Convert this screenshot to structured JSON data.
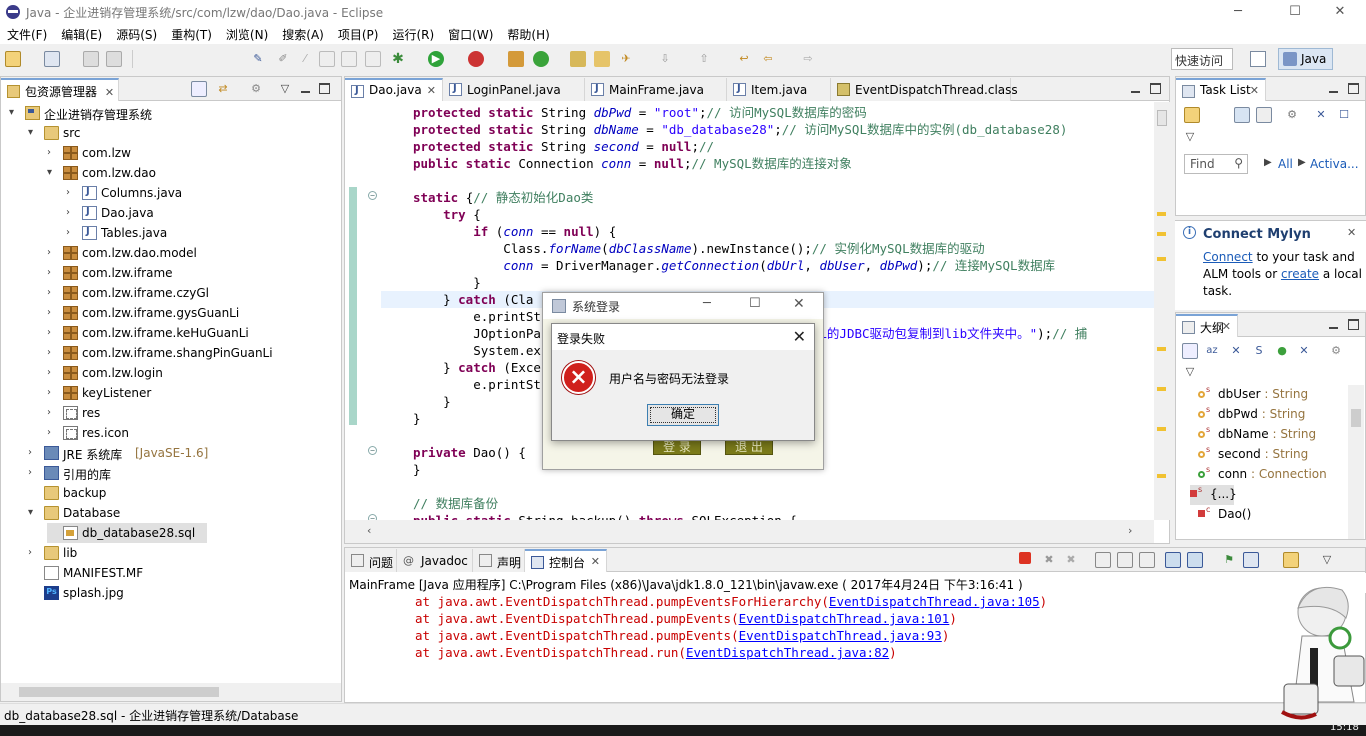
{
  "window": {
    "title": "Java - 企业进销存管理系统/src/com/lzw/dao/Dao.java - Eclipse",
    "min": "─",
    "max": "☐",
    "close": "✕"
  },
  "menu": [
    "文件(F)",
    "编辑(E)",
    "源码(S)",
    "重构(T)",
    "浏览(N)",
    "搜索(A)",
    "项目(P)",
    "运行(R)",
    "窗口(W)",
    "帮助(H)"
  ],
  "toolbar": {
    "quick_access": "快速访问",
    "perspective": "Java"
  },
  "package_explorer": {
    "tab": "包资源管理器",
    "rows": [
      {
        "label": "企业进销存管理系统",
        "twisty": "▾",
        "icon": "project"
      },
      {
        "label": "src",
        "twisty": "▾",
        "icon": "package-folder"
      },
      {
        "label": "com.lzw",
        "twisty": "›",
        "icon": "package"
      },
      {
        "label": "com.lzw.dao",
        "twisty": "▾",
        "icon": "package"
      },
      {
        "label": "Columns.java",
        "twisty": "›",
        "icon": "java-file"
      },
      {
        "label": "Dao.java",
        "twisty": "›",
        "icon": "java-file"
      },
      {
        "label": "Tables.java",
        "twisty": "›",
        "icon": "java-file"
      },
      {
        "label": "com.lzw.dao.model",
        "twisty": "›",
        "icon": "package"
      },
      {
        "label": "com.lzw.iframe",
        "twisty": "›",
        "icon": "package"
      },
      {
        "label": "com.lzw.iframe.czyGl",
        "twisty": "›",
        "icon": "package"
      },
      {
        "label": "com.lzw.iframe.gysGuanLi",
        "twisty": "›",
        "icon": "package"
      },
      {
        "label": "com.lzw.iframe.keHuGuanLi",
        "twisty": "›",
        "icon": "package"
      },
      {
        "label": "com.lzw.iframe.shangPinGuanLi",
        "twisty": "›",
        "icon": "package"
      },
      {
        "label": "com.lzw.login",
        "twisty": "›",
        "icon": "package"
      },
      {
        "label": "keyListener",
        "twisty": "›",
        "icon": "package"
      },
      {
        "label": "res",
        "twisty": "›",
        "icon": "resource-folder"
      },
      {
        "label": "res.icon",
        "twisty": "›",
        "icon": "resource-folder"
      },
      {
        "label": "JRE 系统库",
        "suffix": "[JavaSE-1.6]",
        "twisty": "›",
        "icon": "library"
      },
      {
        "label": "引用的库",
        "twisty": "›",
        "icon": "library"
      },
      {
        "label": "backup",
        "twisty": "",
        "icon": "folder"
      },
      {
        "label": "Database",
        "twisty": "▾",
        "icon": "folder"
      },
      {
        "label": "db_database28.sql",
        "twisty": "",
        "icon": "sql-file"
      },
      {
        "label": "lib",
        "twisty": "›",
        "icon": "folder"
      },
      {
        "label": "MANIFEST.MF",
        "twisty": "",
        "icon": "file"
      },
      {
        "label": "splash.jpg",
        "twisty": "",
        "icon": "image-file"
      }
    ]
  },
  "editor": {
    "tabs": [
      "Dao.java",
      "LoginPanel.java",
      "MainFrame.java",
      "Item.java",
      "EventDispatchThread.class"
    ],
    "lines": [
      [
        [
          "kw",
          "protected static "
        ],
        [
          "t",
          "String "
        ],
        [
          "fld",
          "dbPwd"
        ],
        [
          "t",
          " = "
        ],
        [
          "str",
          "\"root\""
        ],
        [
          "t",
          ";"
        ],
        [
          "cmt",
          "// 访问MySQL数据库的密码"
        ]
      ],
      [
        [
          "kw",
          "protected static "
        ],
        [
          "t",
          "String "
        ],
        [
          "fld",
          "dbName"
        ],
        [
          "t",
          " = "
        ],
        [
          "str",
          "\"db_database28\""
        ],
        [
          "t",
          ";"
        ],
        [
          "cmt",
          "// 访问MySQL数据库中的实例(db_database28)"
        ]
      ],
      [
        [
          "kw",
          "protected static "
        ],
        [
          "t",
          "String "
        ],
        [
          "fld",
          "second"
        ],
        [
          "t",
          " = "
        ],
        [
          "kw",
          "null"
        ],
        [
          "t",
          ";"
        ],
        [
          "cmt",
          "//"
        ]
      ],
      [
        [
          "kw",
          "public static "
        ],
        [
          "t",
          "Connection "
        ],
        [
          "fld",
          "conn"
        ],
        [
          "t",
          " = "
        ],
        [
          "kw",
          "null"
        ],
        [
          "t",
          ";"
        ],
        [
          "cmt",
          "// MySQL数据库的连接对象"
        ]
      ],
      [
        [
          "t",
          ""
        ]
      ],
      [
        [
          "kw",
          "static "
        ],
        [
          "t",
          "{"
        ],
        [
          "cmt",
          "// 静态初始化Dao类"
        ]
      ],
      [
        [
          "t",
          "    "
        ],
        [
          "kw",
          "try "
        ],
        [
          "t",
          "{"
        ]
      ],
      [
        [
          "t",
          "        "
        ],
        [
          "kw",
          "if "
        ],
        [
          "t",
          "("
        ],
        [
          "fld",
          "conn"
        ],
        [
          "t",
          " == "
        ],
        [
          "kw",
          "null"
        ],
        [
          "t",
          ") {"
        ]
      ],
      [
        [
          "t",
          "            Class."
        ],
        [
          "fld",
          "forName"
        ],
        [
          "t",
          "("
        ],
        [
          "fld",
          "dbClassName"
        ],
        [
          "t",
          ").newInstance();"
        ],
        [
          "cmt",
          "// 实例化MySQL数据库的驱动"
        ]
      ],
      [
        [
          "t",
          "            "
        ],
        [
          "fld",
          "conn"
        ],
        [
          "t",
          " = DriverManager."
        ],
        [
          "fld",
          "getConnection"
        ],
        [
          "t",
          "("
        ],
        [
          "fld",
          "dbUrl"
        ],
        [
          "t",
          ", "
        ],
        [
          "fld",
          "dbUser"
        ],
        [
          "t",
          ", "
        ],
        [
          "fld",
          "dbPwd"
        ],
        [
          "t",
          ");"
        ],
        [
          "cmt",
          "// 连接MySQL数据库"
        ]
      ],
      [
        [
          "t",
          "        }"
        ]
      ],
      [
        [
          "t",
          "    } "
        ],
        [
          "kw",
          "catch "
        ],
        [
          "t",
          "(Cla"
        ]
      ],
      [
        [
          "t",
          "        e.printSt"
        ]
      ],
      [
        [
          "t",
          "        JOptionPa"
        ],
        [
          "t",
          "                                    "
        ],
        [
          "str",
          "QL的JDBC驱动包复制到lib文件夹中。\""
        ],
        [
          "t",
          ");"
        ],
        [
          "cmt",
          "// 捕"
        ]
      ],
      [
        [
          "t",
          "        System.ex"
        ]
      ],
      [
        [
          "t",
          "    } "
        ],
        [
          "kw",
          "catch "
        ],
        [
          "t",
          "(Exce"
        ]
      ],
      [
        [
          "t",
          "        e.printSt"
        ]
      ],
      [
        [
          "t",
          "    }"
        ]
      ],
      [
        [
          "t",
          "}"
        ]
      ],
      [
        [
          "t",
          ""
        ]
      ],
      [
        [
          "kw",
          "private "
        ],
        [
          "t",
          "Dao() {"
        ]
      ],
      [
        [
          "t",
          "}"
        ]
      ],
      [
        [
          "t",
          ""
        ]
      ],
      [
        [
          "cmt",
          "// 数据库备份"
        ]
      ],
      [
        [
          "kw",
          "public static "
        ],
        [
          "t",
          "String backup() "
        ],
        [
          "kw",
          "throws "
        ],
        [
          "t",
          "SQLException {"
        ]
      ]
    ]
  },
  "task_list": {
    "tab": "Task List",
    "find_placeholder": "Find",
    "all": "All",
    "activate": "Activa..."
  },
  "mylyn": {
    "title": "Connect Mylyn",
    "link1": "Connect",
    "text1": " to your task and ALM tools or ",
    "link2": "create",
    "text2": " a local task."
  },
  "outline": {
    "tab": "大纲",
    "items": [
      {
        "name": "dbUser",
        "type": " : String",
        "kind": "protected-static"
      },
      {
        "name": "dbPwd",
        "type": " : String",
        "kind": "protected-static"
      },
      {
        "name": "dbName",
        "type": " : String",
        "kind": "protected-static"
      },
      {
        "name": "second",
        "type": " : String",
        "kind": "protected-static"
      },
      {
        "name": "conn",
        "type": " : Connection",
        "kind": "public-static"
      },
      {
        "name": "{...}",
        "type": "",
        "kind": "static-init"
      },
      {
        "name": "Dao()",
        "type": "",
        "kind": "constructor"
      }
    ]
  },
  "console": {
    "tabs": [
      "问题",
      "Javadoc",
      "声明",
      "控制台"
    ],
    "header": "MainFrame [Java 应用程序] C:\\Program Files (x86)\\Java\\jdk1.8.0_121\\bin\\javaw.exe ( 2017年4月24日 下午3:16:41 )",
    "lines": [
      {
        "pre": "at java.awt.EventDispatchThread.pumpEventsForHierarchy(",
        "link": "EventDispatchThread.java:105",
        "post": ")"
      },
      {
        "pre": "at java.awt.EventDispatchThread.pumpEvents(",
        "link": "EventDispatchThread.java:101",
        "post": ")"
      },
      {
        "pre": "at java.awt.EventDispatchThread.pumpEvents(",
        "link": "EventDispatchThread.java:93",
        "post": ")"
      },
      {
        "pre": "at java.awt.EventDispatchThread.run(",
        "link": "EventDispatchThread.java:82",
        "post": ")"
      }
    ]
  },
  "status_bar": {
    "text": "db_database28.sql - 企业进销存管理系统/Database"
  },
  "login_window": {
    "title": "系统登录",
    "login_btn": "登 录",
    "exit_btn": "退 出"
  },
  "error_dialog": {
    "title": "登录失败",
    "message": "用户名与密码无法登录",
    "ok": "确定",
    "icon": "×"
  },
  "taskbar_clock": "15:18"
}
